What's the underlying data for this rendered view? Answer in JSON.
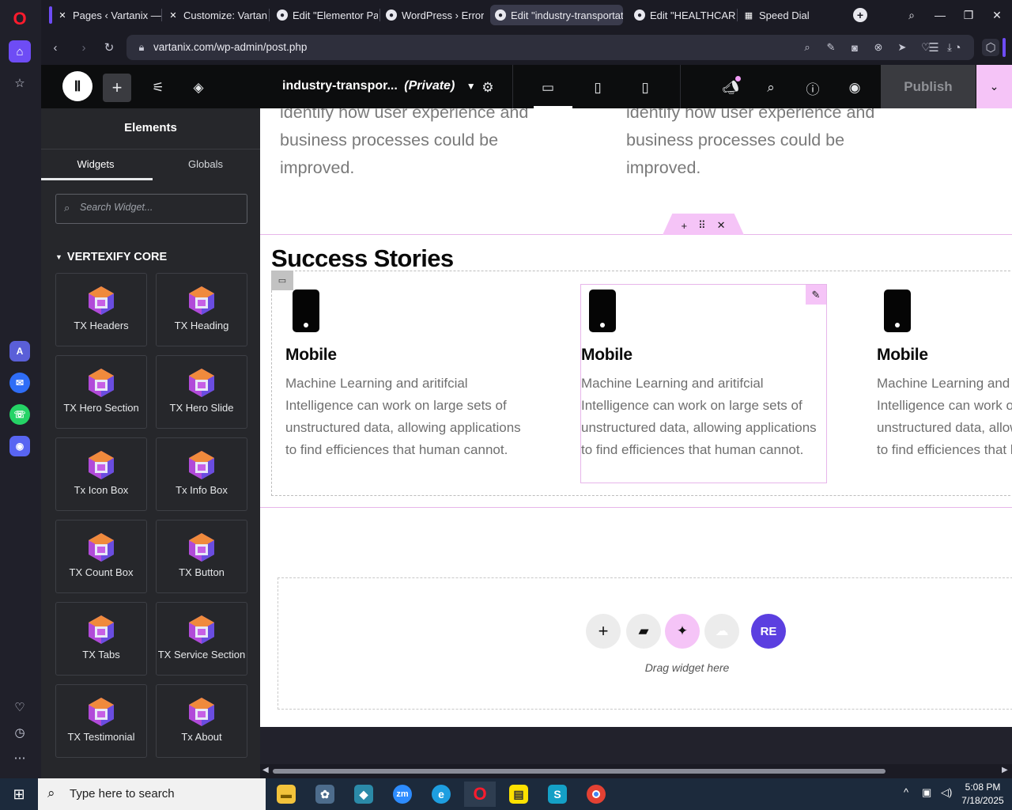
{
  "browser": {
    "tabs": [
      {
        "label": "Pages ‹ Vartanix — W",
        "icon": "vertexify-x-icon"
      },
      {
        "label": "Customize: Vartanix",
        "icon": "vertexify-x-icon"
      },
      {
        "label": "Edit \"Elementor Page",
        "icon": "globe-icon"
      },
      {
        "label": "WordPress › Error",
        "icon": "globe-icon"
      },
      {
        "label": "Edit \"industry-transportati",
        "icon": "globe-icon"
      },
      {
        "label": "Edit \"HEALTHCARE\"",
        "icon": "globe-icon"
      },
      {
        "label": "Speed Dial",
        "icon": "grid-icon"
      }
    ],
    "url": "vartanix.com/wp-admin/post.php"
  },
  "elementor": {
    "doc_title": "industry-transpor...",
    "doc_status": "(Private)",
    "publish_label": "Publish",
    "panel": {
      "title": "Elements",
      "tabs": [
        "Widgets",
        "Globals"
      ],
      "search_placeholder": "Search Widget...",
      "category": "VERTEXIFY CORE",
      "widgets": [
        "TX Headers",
        "TX Heading",
        "TX Hero Section",
        "TX Hero Slide",
        "Tx Icon Box",
        "Tx Info Box",
        "TX Count Box",
        "TX Button",
        "TX Tabs",
        "TX Service Section",
        "TX Testimonial",
        "Tx About"
      ]
    }
  },
  "canvas": {
    "intro_text_lines": [
      "identify how user experience and",
      "business processes could be",
      "improved."
    ],
    "section_title": "Success Stories",
    "cards": [
      {
        "title": "Mobile",
        "desc": "Machine Learning and aritifcial Intelligence can work on large sets of unstructured data, allowing applications to find efficiences that human cannot."
      },
      {
        "title": "Mobile",
        "desc": "Machine Learning and aritifcial Intelligence can work on large sets of unstructured data, allowing applications to find efficiences that human cannot."
      },
      {
        "title": "Mobile",
        "desc": "Machine Learning and aritifcial Intelligence can work on large sets of unstructured data, allowing applications to find efficiences that human cannot."
      }
    ],
    "drop_text": "Drag widget here"
  },
  "taskbar": {
    "search_placeholder": "Type here to search",
    "time": "5:08 PM",
    "date": "7/18/2025"
  },
  "colors": {
    "accent_pink": "#f5c4f7",
    "panel_bg": "#26272b",
    "topbar_bg": "#0c0d0e"
  }
}
